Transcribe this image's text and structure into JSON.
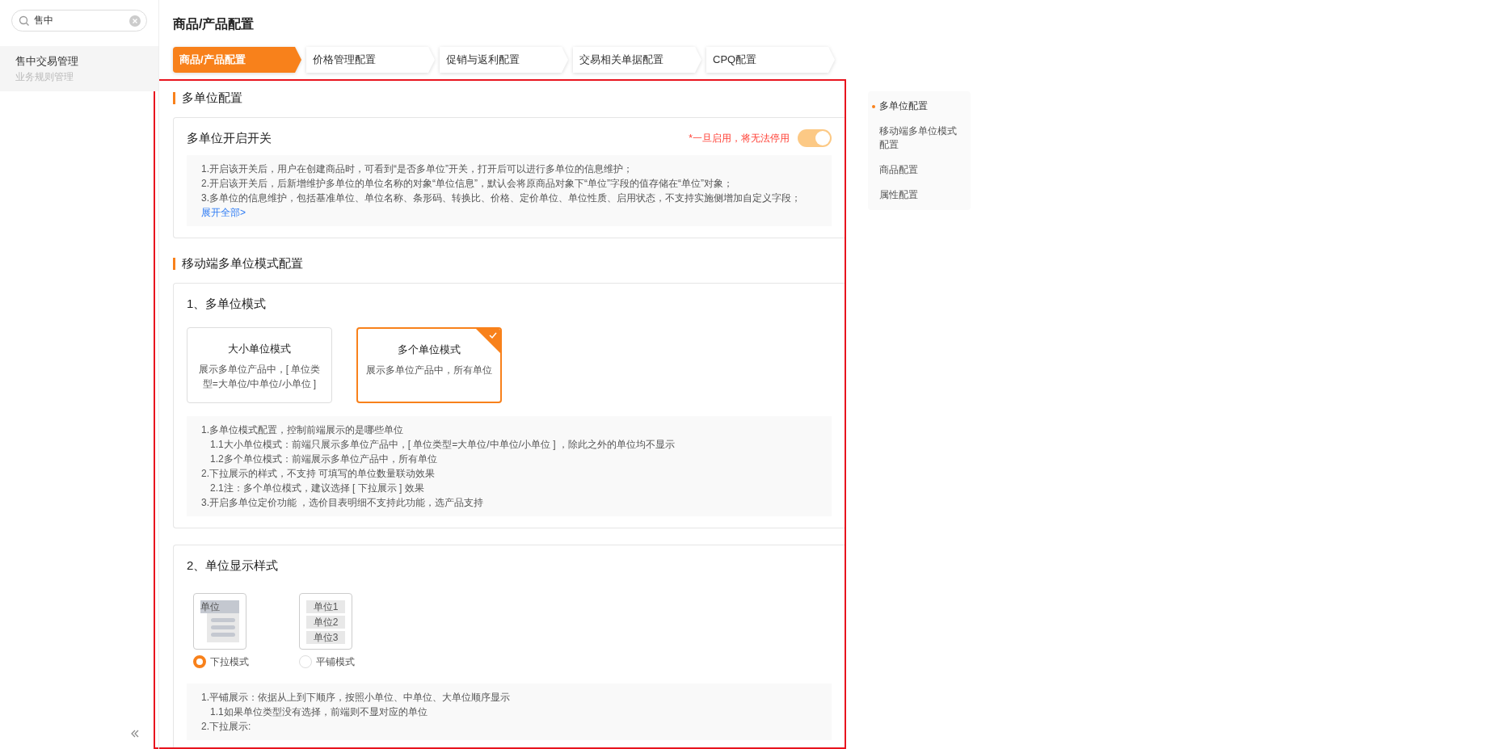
{
  "sidebar": {
    "search": {
      "value": "售中"
    },
    "items": [
      {
        "title": "售中交易管理",
        "subtitle": "业务规则管理",
        "selected": true
      }
    ]
  },
  "page_title": "商品/产品配置",
  "tabs": [
    {
      "label": "商品/产品配置",
      "selected": true
    },
    {
      "label": "价格管理配置",
      "selected": false
    },
    {
      "label": "促销与返利配置",
      "selected": false
    },
    {
      "label": "交易相关单据配置",
      "selected": false
    },
    {
      "label": "CPQ配置",
      "selected": false
    }
  ],
  "sections": [
    {
      "heading": "多单位配置",
      "cards": [
        {
          "kind": "switch",
          "title": "多单位开启开关",
          "warning": "*一旦启用，将无法停用",
          "toggle": {
            "on": true,
            "disabled": true
          },
          "notes": [
            {
              "text": "1.开启该开关后，用户在创建商品时，可看到“是否多单位”开关，打开后可以进行多单位的信息维护；"
            },
            {
              "text": "2.开启该开关后，后新增维护多单位的单位名称的对象“单位信息”，默认会将原商品对象下“单位”字段的值存储在“单位”对象；"
            },
            {
              "text": "3.多单位的信息维护，包括基准单位、单位名称、条形码、转换比、价格、定价单位、单位性质、启用状态，不支持实施侧增加自定义字段；"
            }
          ],
          "link": "展开全部>"
        }
      ]
    },
    {
      "heading": "移动端多单位模式配置",
      "cards": [
        {
          "kind": "modes",
          "title": "1、多单位模式",
          "options": [
            {
              "title": "大小单位模式",
              "desc": "展示多单位产品中，[ 单位类型=大单位/中单位/小单位 ]",
              "selected": false
            },
            {
              "title": "多个单位模式",
              "desc": "展示多单位产品中，所有单位",
              "selected": true
            }
          ],
          "notes": [
            {
              "text": "1.多单位模式配置，控制前端展示的是哪些单位",
              "children": [
                {
                  "text": "1.1大小单位模式：前端只展示多单位产品中，[ 单位类型=大单位/中单位/小单位 ] ，除此之外的单位均不显示"
                },
                {
                  "text": "1.2多个单位模式：前端展示多单位产品中，所有单位"
                }
              ]
            },
            {
              "text": "2.下拉展示的样式，不支持 可填写的单位数量联动效果",
              "children": [
                {
                  "text": "2.1注：多个单位模式，建议选择 [ 下拉展示 ] 效果"
                }
              ]
            },
            {
              "text": "3.开启多单位定价功能 ，选价目表明细不支持此功能，选产品支持"
            }
          ]
        },
        {
          "kind": "styles",
          "title": "2、单位显示样式",
          "options": [
            {
              "kind": "dropdown",
              "label": "下拉模式",
              "preview_labels": [
                "单位"
              ],
              "selected": true
            },
            {
              "kind": "tiles",
              "label": "平铺模式",
              "preview_labels": [
                "单位1",
                "单位2",
                "单位3"
              ],
              "selected": false
            }
          ],
          "notes": [
            {
              "text": "1.平铺展示：依据从上到下顺序，按照小单位、中单位、大单位顺序显示",
              "children": [
                {
                  "text": "1.1如果单位类型没有选择，前端则不显对应的单位"
                }
              ]
            },
            {
              "text": "2.下拉展示:"
            }
          ]
        }
      ]
    }
  ],
  "anchor_nav": [
    {
      "label": "多单位配置",
      "selected": true
    },
    {
      "label": "移动端多单位模式配置",
      "selected": false
    },
    {
      "label": "商品配置",
      "selected": false
    },
    {
      "label": "属性配置",
      "selected": false
    }
  ]
}
